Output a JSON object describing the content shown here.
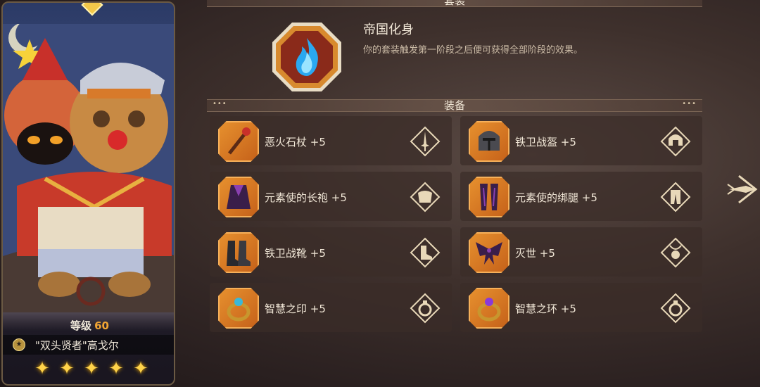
{
  "hero": {
    "level_label": "等级",
    "level": "60",
    "name": "\"双头贤者\"高戈尔",
    "stars": 5,
    "star_glyph": "✦"
  },
  "set_section": {
    "header": "套装",
    "name": "帝国化身",
    "description": "你的套装触发第一阶段之后便可获得全部阶段的效果。"
  },
  "equipment_section": {
    "header": "装备",
    "items": [
      {
        "name": "恶火石杖 +5",
        "icon": "staff-icon",
        "slot": "weapon-slot-icon"
      },
      {
        "name": "铁卫战盔 +5",
        "icon": "helmet-icon",
        "slot": "helmet-slot-icon"
      },
      {
        "name": "元素使的长袍 +5",
        "icon": "robe-icon",
        "slot": "armor-slot-icon"
      },
      {
        "name": "元素使的绑腿 +5",
        "icon": "leggings-icon",
        "slot": "legs-slot-icon"
      },
      {
        "name": "铁卫战靴 +5",
        "icon": "boots-icon",
        "slot": "boots-slot-icon"
      },
      {
        "name": "灭世 +5",
        "icon": "wings-icon",
        "slot": "amulet-slot-icon"
      },
      {
        "name": "智慧之印 +5",
        "icon": "ring-icon",
        "slot": "ring-slot-icon"
      },
      {
        "name": "智慧之环 +5",
        "icon": "ring-icon",
        "slot": "ring-slot-icon"
      }
    ]
  },
  "colors": {
    "accent_orange": "#e6902e",
    "level_number": "#f2a533",
    "star": "#ffd34a"
  }
}
